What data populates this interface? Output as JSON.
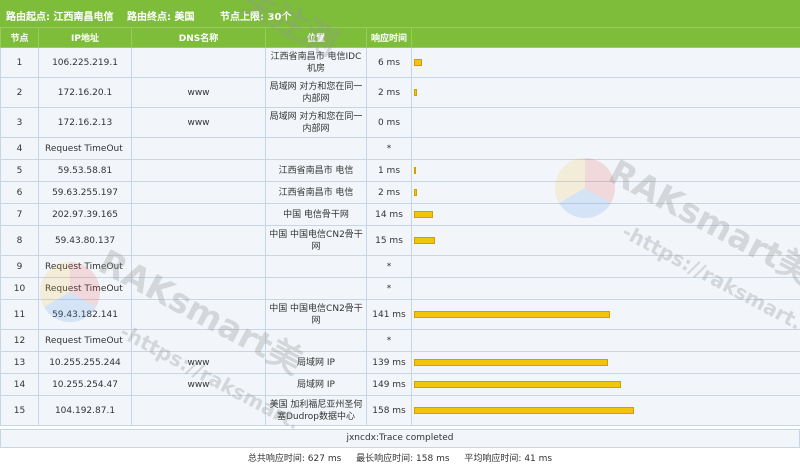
{
  "header": {
    "start": "路由起点: 江西南昌电信",
    "end": "路由终点: 美国",
    "limit": "节点上限: 30个"
  },
  "columns": [
    "节点",
    "IP地址",
    "DNS名称",
    "位置",
    "响应时间",
    ""
  ],
  "rows": [
    {
      "hop": "1",
      "ip": "106.225.219.1",
      "dns": "",
      "loc": "江西省南昌市 电信IDC机房",
      "time": "6 ms",
      "ms": 6
    },
    {
      "hop": "2",
      "ip": "172.16.20.1",
      "dns": "www",
      "loc": "局域网 对方和您在同一内部网",
      "time": "2 ms",
      "ms": 2
    },
    {
      "hop": "3",
      "ip": "172.16.2.13",
      "dns": "www",
      "loc": "局域网 对方和您在同一内部网",
      "time": "0 ms",
      "ms": 0
    },
    {
      "hop": "4",
      "ip": "Request TimeOut",
      "dns": "",
      "loc": "",
      "time": "*",
      "ms": null
    },
    {
      "hop": "5",
      "ip": "59.53.58.81",
      "dns": "",
      "loc": "江西省南昌市 电信",
      "time": "1 ms",
      "ms": 1
    },
    {
      "hop": "6",
      "ip": "59.63.255.197",
      "dns": "",
      "loc": "江西省南昌市 电信",
      "time": "2 ms",
      "ms": 2
    },
    {
      "hop": "7",
      "ip": "202.97.39.165",
      "dns": "",
      "loc": "中国 电信骨干网",
      "time": "14 ms",
      "ms": 14
    },
    {
      "hop": "8",
      "ip": "59.43.80.137",
      "dns": "",
      "loc": "中国 中国电信CN2骨干网",
      "time": "15 ms",
      "ms": 15
    },
    {
      "hop": "9",
      "ip": "Request TimeOut",
      "dns": "",
      "loc": "",
      "time": "*",
      "ms": null
    },
    {
      "hop": "10",
      "ip": "Request TimeOut",
      "dns": "",
      "loc": "",
      "time": "*",
      "ms": null
    },
    {
      "hop": "11",
      "ip": "59.43.182.141",
      "dns": "",
      "loc": "中国 中国电信CN2骨干网",
      "time": "141 ms",
      "ms": 141
    },
    {
      "hop": "12",
      "ip": "Request TimeOut",
      "dns": "",
      "loc": "",
      "time": "*",
      "ms": null
    },
    {
      "hop": "13",
      "ip": "10.255.255.244",
      "dns": "www",
      "loc": "局域网 IP",
      "time": "139 ms",
      "ms": 139
    },
    {
      "hop": "14",
      "ip": "10.255.254.47",
      "dns": "www",
      "loc": "局域网 IP",
      "time": "149 ms",
      "ms": 149
    },
    {
      "hop": "15",
      "ip": "104.192.87.1",
      "dns": "",
      "loc": "美国 加利福尼亚州圣何塞Dudrop数据中心",
      "time": "158 ms",
      "ms": 158
    }
  ],
  "footer": {
    "status": "jxncdx:Trace completed",
    "total": "总共响应时间:  627 ms",
    "max": "最长响应时间:  158 ms",
    "avg": "平均响应时间:  41 ms"
  },
  "watermark": {
    "brand": "RAKsmart美",
    "url": "-https://raksmart.",
    "url2": "-https://raksmart.",
    "brand2": "RAKsmart美",
    "brand3": "RAKsmart美",
    "url3": "-https://raksmart.",
    "top": "关注测"
  },
  "colors": {
    "header_bg": "#7dbd3a",
    "cell_bg": "#f2f6fa",
    "bar": "#f1c40f"
  }
}
